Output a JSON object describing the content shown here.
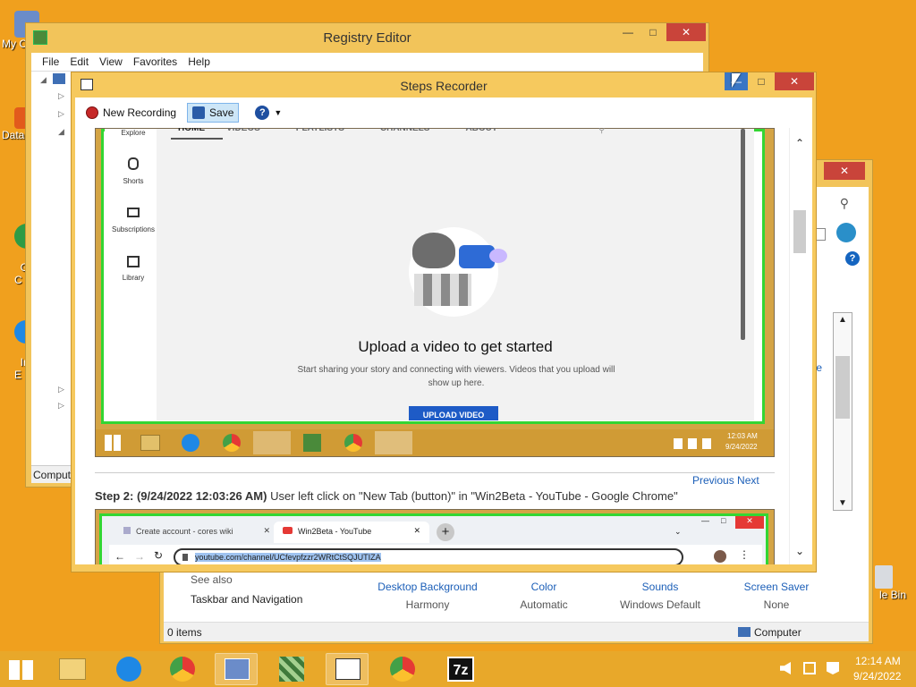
{
  "desktop": {
    "icons": [
      {
        "label": "My C"
      },
      {
        "label": "Data"
      },
      {
        "label": "G\nC"
      },
      {
        "label": "In\nE"
      },
      {
        "label": "le Bin"
      }
    ]
  },
  "registry": {
    "title": "Registry Editor",
    "menu": [
      "File",
      "Edit",
      "View",
      "Favorites",
      "Help"
    ],
    "status": "Comput"
  },
  "control_panel": {
    "see_also": "See also",
    "taskbar_nav": "Taskbar and Navigation",
    "links": [
      {
        "label": "Desktop Background",
        "value": "Harmony"
      },
      {
        "label": "Color",
        "value": "Automatic"
      },
      {
        "label": "Sounds",
        "value": "Windows Default"
      },
      {
        "label": "Screen Saver",
        "value": "None"
      }
    ],
    "partial_link": "e",
    "status_items": "0 items",
    "status_computer": "Computer"
  },
  "steps_recorder": {
    "title": "Steps Recorder",
    "new_recording": "New Recording",
    "save": "Save",
    "prev_next": "Previous Next",
    "step2_header": "Step 2: (9/24/2022 12:03:26 AM)",
    "step2_text": " User left click on \"New Tab (button)\" in \"Win2Beta - YouTube - Google Chrome\"",
    "shot1": {
      "yt_tabs": [
        "HOME",
        "VIDEOS",
        "PLAYLISTS",
        "CHANNELS",
        "ABOUT"
      ],
      "sidebar": [
        "Explore",
        "Shorts",
        "Subscriptions",
        "Library"
      ],
      "upload_title": "Upload a video to get started",
      "upload_sub": "Start sharing your story and connecting with viewers. Videos that you upload will show up here.",
      "upload_btn": "UPLOAD VIDEO",
      "clock_time": "12:03 AM",
      "clock_date": "9/24/2022"
    },
    "shot2": {
      "tab1": "Create account - cores wiki",
      "tab2": "Win2Beta - YouTube",
      "url": "youtube.com/channel/UCfevpfzzr2WRtCtSQJUTIZA"
    }
  },
  "taskbar": {
    "time": "12:14 AM",
    "date": "9/24/2022",
    "apps": [
      "file-explorer",
      "internet-explorer",
      "chrome",
      "remote-desktop",
      "package",
      "steps-recorder",
      "chrome",
      "7zip"
    ]
  },
  "colors": {
    "desktop": "#f0a01e",
    "window_frame": "#f6c95e",
    "accent_blue": "#1c5fb8",
    "highlight_green": "#33d633"
  }
}
